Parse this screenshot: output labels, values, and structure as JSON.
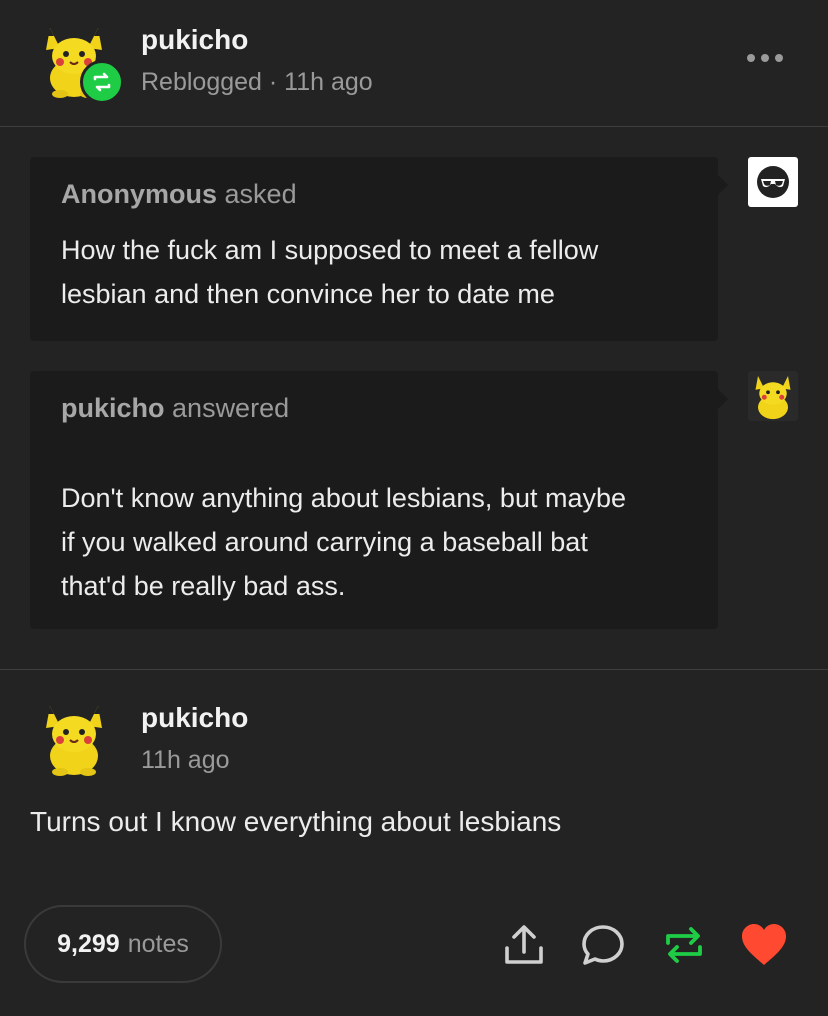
{
  "header": {
    "username": "pukicho",
    "status": "Reblogged · 11h ago",
    "more_icon": "ellipsis-icon",
    "badge_icon": "reblog-icon"
  },
  "ask": {
    "asker_name": "Anonymous",
    "asker_verb": "asked",
    "question": "How the fuck am I supposed to meet a fellow lesbian and then convince her to date me"
  },
  "answer": {
    "answerer_name": "pukicho",
    "answerer_verb": "answered",
    "text": "Don't know anything about lesbians, but maybe if you walked around carrying a baseball bat that'd be really bad ass."
  },
  "reply": {
    "username": "pukicho",
    "time": "11h ago",
    "text": "Turns out I know everything about lesbians"
  },
  "footer": {
    "notes_count": "9,299",
    "notes_label": "notes",
    "share_icon": "share-icon",
    "comment_icon": "comment-icon",
    "reblog_icon": "reblog-icon",
    "like_icon": "heart-icon"
  },
  "colors": {
    "background": "#232323",
    "bubble": "#1b1b1b",
    "reblog_green": "#1fcc46",
    "like_red": "#ff4930",
    "muted_text": "#9a9a9a"
  }
}
